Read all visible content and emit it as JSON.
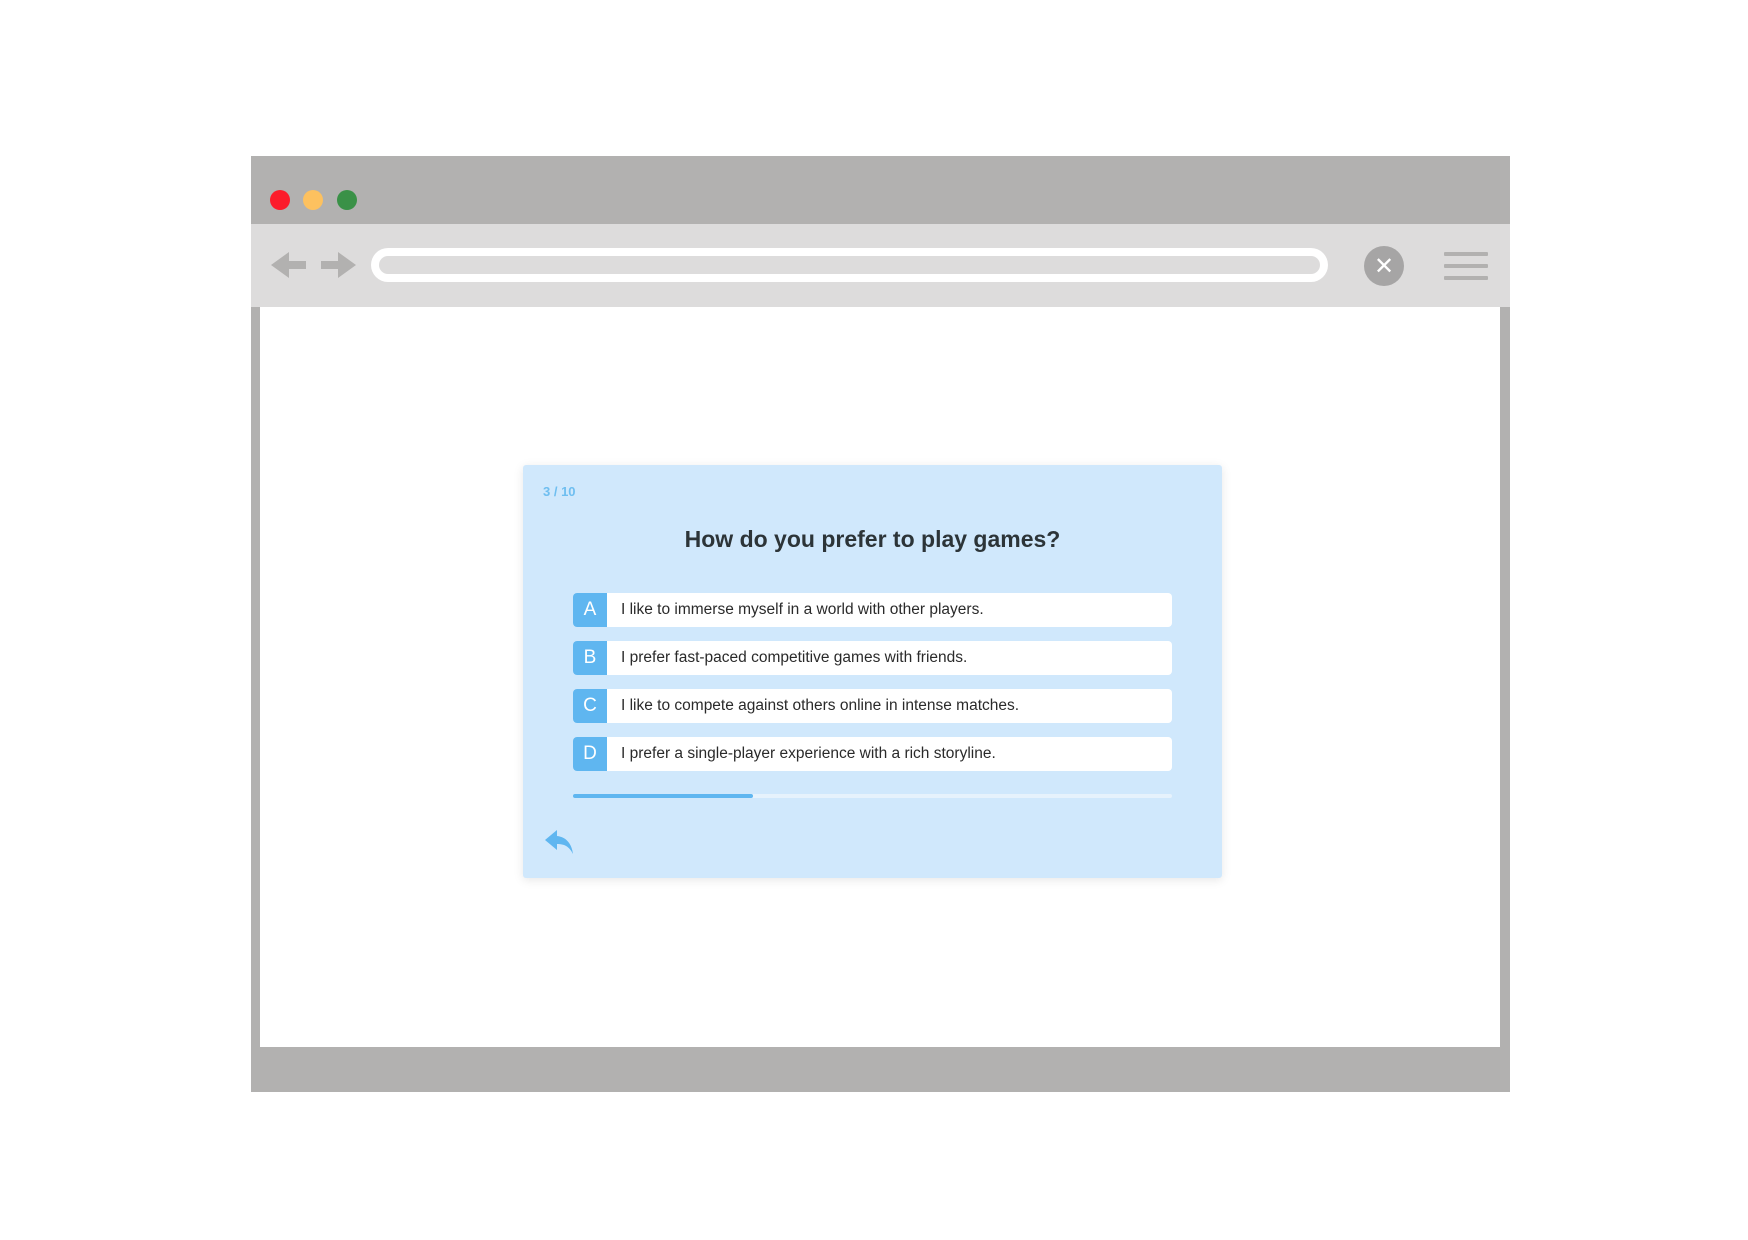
{
  "window": {
    "traffic_lights": {
      "close_color": "#fc1c2b",
      "minimize_color": "#fdc15f",
      "maximize_color": "#3a9147"
    },
    "icons": {
      "back": "arrow-left-icon",
      "forward": "arrow-right-icon",
      "close": "close-icon",
      "menu": "hamburger-menu-icon"
    },
    "close_glyph": "✕",
    "url": ""
  },
  "quiz": {
    "counter": "3 / 10",
    "progress": {
      "current": 3,
      "total": 10
    },
    "question": "How do you prefer to play games?",
    "options": [
      {
        "letter": "A",
        "text": "I like to immerse myself in a world with other players."
      },
      {
        "letter": "B",
        "text": "I prefer fast-paced competitive games with friends."
      },
      {
        "letter": "C",
        "text": "I like to compete against others online in intense matches."
      },
      {
        "letter": "D",
        "text": "I prefer a single-player experience with a rich storyline."
      }
    ],
    "back_icon": "reply-back-icon",
    "accent_color": "#5fb6f0",
    "card_color": "#d0e8fc"
  }
}
